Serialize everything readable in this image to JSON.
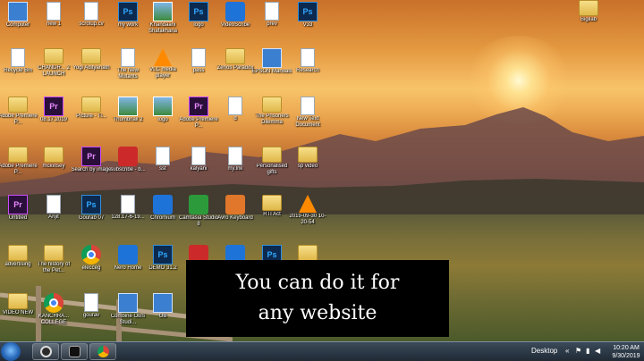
{
  "desktop": {
    "icons": [
      {
        "label": "Computer",
        "type": "screen"
      },
      {
        "label": "new 1",
        "type": "doc"
      },
      {
        "label": "scrotup.cv",
        "type": "doc"
      },
      {
        "label": "my work",
        "type": "ps"
      },
      {
        "label": "Khandaani Shafakhana",
        "type": "photo"
      },
      {
        "label": "logo",
        "type": "ps"
      },
      {
        "label": "VideoScribe",
        "type": "blue"
      },
      {
        "label": "prev",
        "type": "doc"
      },
      {
        "label": "V33",
        "type": "ps"
      },
      {
        "label": "Bigilab",
        "type": "folder"
      },
      {
        "label": "Recycle Bin",
        "type": "doc"
      },
      {
        "label": "CHANDR... 2 LAUNCH",
        "type": "folder"
      },
      {
        "label": "Yogi Adityanath",
        "type": "folder"
      },
      {
        "label": "The New Mutants",
        "type": "doc"
      },
      {
        "label": "VLC media player",
        "type": "vlc"
      },
      {
        "label": "pass",
        "type": "doc"
      },
      {
        "label": "Zenos Paradox",
        "type": "folder"
      },
      {
        "label": "EPSON Manuals",
        "type": "screen"
      },
      {
        "label": "Research",
        "type": "doc"
      },
      {
        "label": "Adobe Premiere P...",
        "type": "folder"
      },
      {
        "label": "08.17.2019",
        "type": "pr"
      },
      {
        "label": "Picture - Ti...",
        "type": "folder"
      },
      {
        "label": "Thumbnail 2",
        "type": "photo"
      },
      {
        "label": "logo",
        "type": "photo"
      },
      {
        "label": "Adobe Premiere P...",
        "type": "pr"
      },
      {
        "label": "d",
        "type": "doc"
      },
      {
        "label": "The Prisoners Dilemma",
        "type": "folder"
      },
      {
        "label": "New Text Document",
        "type": "doc"
      },
      {
        "label": "Adobe Premiere P...",
        "type": "folder"
      },
      {
        "label": "mckinsey",
        "type": "folder"
      },
      {
        "label": "Search by image",
        "type": "pr"
      },
      {
        "label": "subscribe - b...",
        "type": "red"
      },
      {
        "label": "sst",
        "type": "doc"
      },
      {
        "label": "kalyani",
        "type": "doc"
      },
      {
        "label": "my.lnk",
        "type": "doc"
      },
      {
        "label": "Personalised gifts",
        "type": "folder"
      },
      {
        "label": "sp video",
        "type": "folder"
      },
      {
        "label": "Untitled",
        "type": "pr"
      },
      {
        "label": "Anjit",
        "type": "doc"
      },
      {
        "label": "Gourab 07",
        "type": "ps"
      },
      {
        "label": "128.17-6-19...",
        "type": "doc"
      },
      {
        "label": "Chromium",
        "type": "blue"
      },
      {
        "label": "Camtasia Studio 8",
        "type": "green"
      },
      {
        "label": "Avro Keyboard",
        "type": "orange"
      },
      {
        "label": "RTI Act",
        "type": "folder"
      },
      {
        "label": "2019-09-30 10-20-54",
        "type": "vlc"
      },
      {
        "label": "advertising",
        "type": "folder"
      },
      {
        "label": "The history of the Pet...",
        "type": "folder"
      },
      {
        "label": "elecceg",
        "type": "chrome"
      },
      {
        "label": "Nero Home",
        "type": "blue"
      },
      {
        "label": "DEMO 31.2",
        "type": "ps"
      },
      {
        "label": "",
        "type": "red"
      },
      {
        "label": "",
        "type": "blue"
      },
      {
        "label": "",
        "type": "ps"
      },
      {
        "label": "BKDFPKG",
        "type": "folder"
      },
      {
        "label": "VIDEO NEW",
        "type": "folder"
      },
      {
        "label": "KANCHRA... COLLEGE",
        "type": "chrome"
      },
      {
        "label": "gourav",
        "type": "doc"
      },
      {
        "label": "Combine OBS Studi...",
        "type": "screen"
      },
      {
        "label": "OB",
        "type": "screen"
      }
    ]
  },
  "caption": {
    "line1": "You can do it for",
    "line2": "any website"
  },
  "taskbar": {
    "pinned": [
      {
        "name": "obs",
        "color": "#2b2b2b"
      },
      {
        "name": "terminal",
        "color": "#111111"
      },
      {
        "name": "chrome",
        "color": "#e0a020"
      }
    ],
    "desktop_label": "Desktop",
    "clock_time": "10:20 AM",
    "clock_date": "9/30/2019"
  }
}
